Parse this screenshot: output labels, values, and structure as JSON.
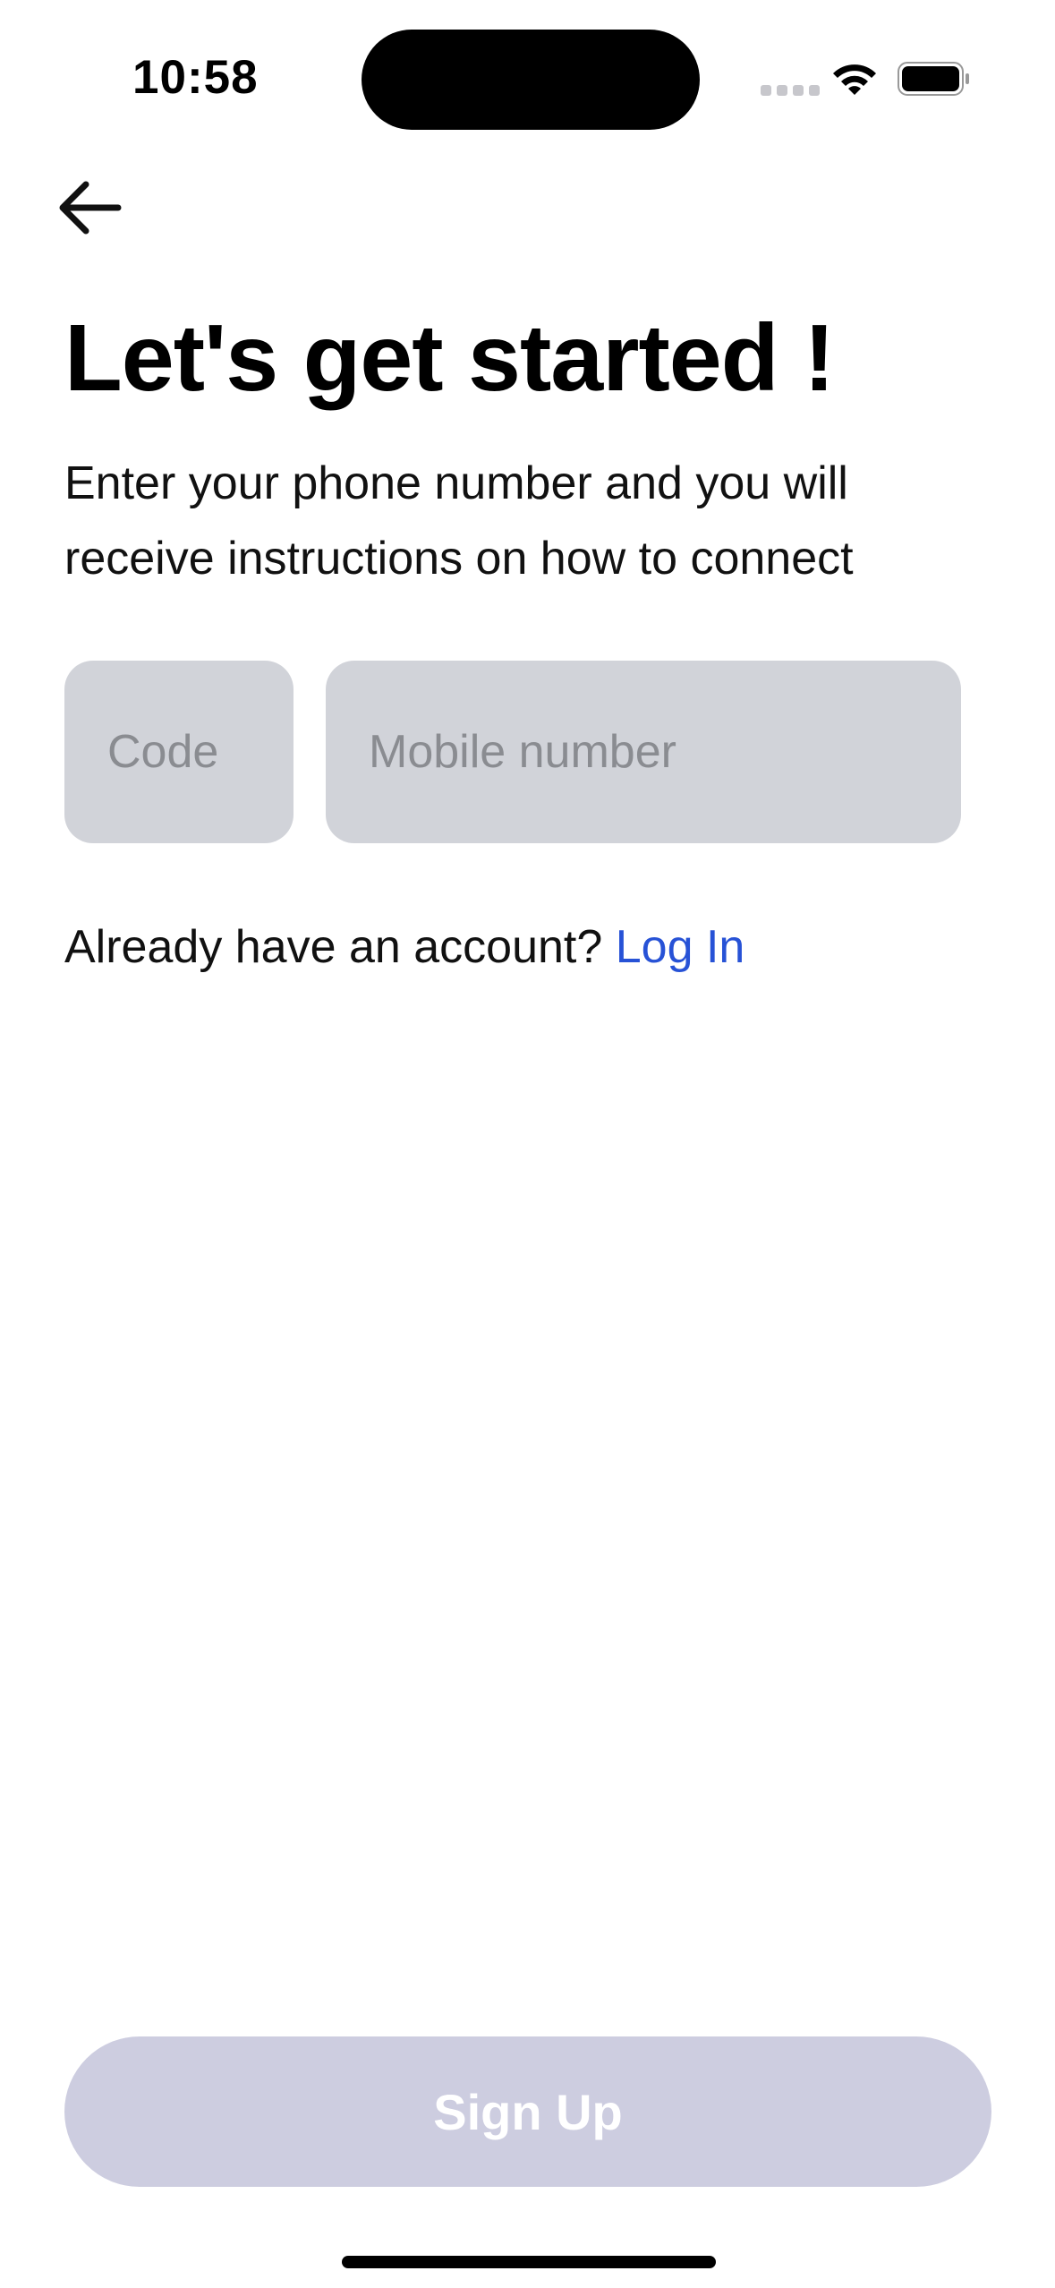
{
  "status_bar": {
    "time": "10:58",
    "icons": [
      "signal-icon",
      "wifi-icon",
      "battery-icon"
    ]
  },
  "nav": {
    "back_icon": "arrow-left-icon"
  },
  "main": {
    "title": "Let's get started !",
    "subtitle": "Enter your phone number and you will receive instructions on how to connect",
    "code_input": {
      "placeholder": "Code",
      "value": ""
    },
    "mobile_input": {
      "placeholder": "Mobile number",
      "value": ""
    },
    "account_prompt": "Already have an account?",
    "login_link": "Log In"
  },
  "footer": {
    "signup_label": "Sign Up"
  },
  "colors": {
    "link": "#2752d6",
    "input_bg": "#d1d3d9",
    "button_disabled_bg": "#cdcde0",
    "button_text": "#ffffff"
  }
}
